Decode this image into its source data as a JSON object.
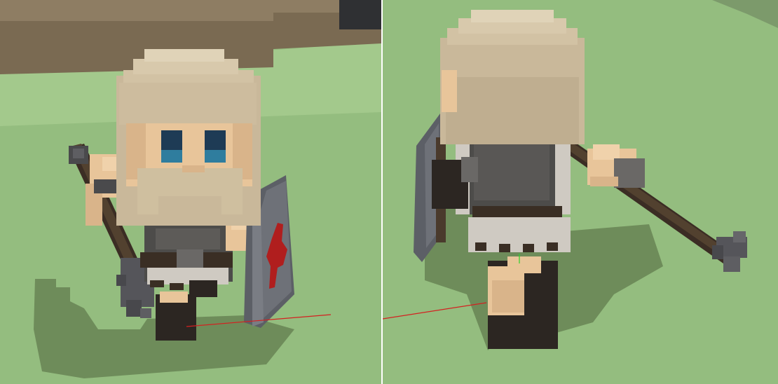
{
  "scene": {
    "left_view": "front-view",
    "right_view": "back-view"
  },
  "colors": {
    "ground": "#94bd7f",
    "ground_shadow": "#6e8c5a",
    "wall": "#7a6a52",
    "wall_top": "#8e7d63",
    "hair": "#c9b89a",
    "hair_light": "#d8c9ac",
    "skin": "#e8c59a",
    "skin_shadow": "#c9a07a",
    "eye": "#1e3b55",
    "eye_highlight": "#2f7d9e",
    "armor": "#4d4c4a",
    "armor_light": "#6a6866",
    "belt": "#3a2e24",
    "cloth": "#cfcac2",
    "boot": "#2c2622",
    "staff": "#3b2d24",
    "shield": "#5c5f66",
    "shield_rim": "#7a7d84",
    "emblem": "#b01e1e",
    "mace": "#5a5a5e",
    "axis_x": "#d42020"
  }
}
